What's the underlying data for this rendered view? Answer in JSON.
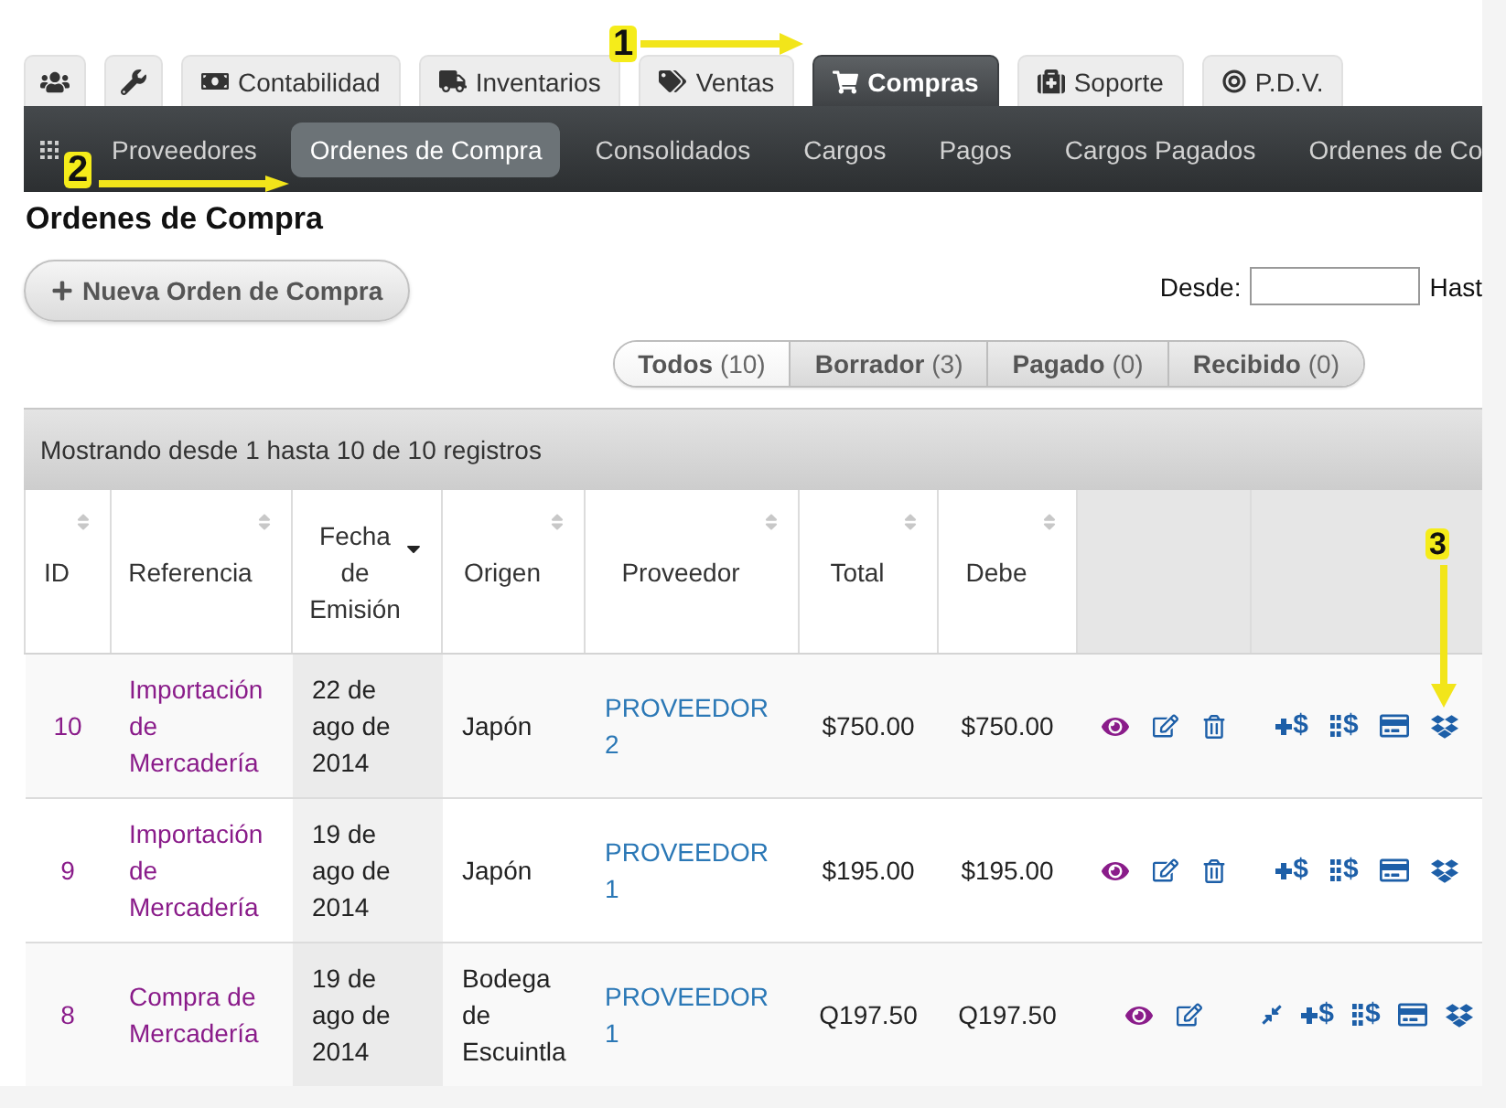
{
  "top_tabs": [
    {
      "selected": false
    },
    {
      "selected": false
    },
    {
      "label": "Contabilidad",
      "selected": false
    },
    {
      "label": "Inventarios",
      "selected": false
    },
    {
      "label": "Ventas",
      "selected": false
    },
    {
      "label": "Compras",
      "selected": true
    },
    {
      "label": "Soporte",
      "selected": false
    },
    {
      "label": "P.D.V.",
      "selected": false
    }
  ],
  "sub_nav": {
    "items": [
      {
        "label": "Proveedores",
        "selected": false
      },
      {
        "label": "Ordenes de Compra",
        "selected": true
      },
      {
        "label": "Consolidados",
        "selected": false
      },
      {
        "label": "Cargos",
        "selected": false
      },
      {
        "label": "Pagos",
        "selected": false
      },
      {
        "label": "Cargos Pagados",
        "selected": false
      },
      {
        "label": "Ordenes de Co",
        "selected": false
      }
    ]
  },
  "page_title": "Ordenes de Compra",
  "new_order_button": {
    "label": "Nueva Orden de Compra"
  },
  "date_filter": {
    "from_label": "Desde:",
    "to_label": "Hast"
  },
  "status_filters": [
    {
      "label": "Todos",
      "count": "(10)",
      "selected": true
    },
    {
      "label": "Borrador",
      "count": "(3)",
      "selected": false
    },
    {
      "label": "Pagado",
      "count": "(0)",
      "selected": false
    },
    {
      "label": "Recibido",
      "count": "(0)",
      "selected": false
    }
  ],
  "records_info": "Mostrando desde 1 hasta 10 de 10 registros",
  "table": {
    "columns": [
      {
        "kind": "data",
        "label": "ID",
        "sorted": false
      },
      {
        "kind": "data",
        "label": "Referencia",
        "sorted": false
      },
      {
        "kind": "data",
        "label": "Fecha de Emisión",
        "sorted": true
      },
      {
        "kind": "data",
        "label": "Origen",
        "sorted": false
      },
      {
        "kind": "data",
        "label": "Proveedor",
        "sorted": false
      },
      {
        "kind": "data",
        "label": "Total",
        "sorted": false
      },
      {
        "kind": "data",
        "label": "Debe",
        "sorted": false
      },
      {
        "kind": "actions"
      },
      {
        "kind": "actions"
      }
    ],
    "rows": [
      {
        "id": "10",
        "reference": "Importación de Mercadería",
        "date": "22 de ago de 2014",
        "origin": "Japón",
        "supplier": "PROVEEDOR 2",
        "total": "$750.00",
        "due": "$750.00",
        "record_actions": [
          {
            "kind": "view"
          },
          {
            "kind": "edit"
          },
          {
            "kind": "delete"
          }
        ],
        "payment_actions": [
          {
            "kind": "add-payment",
            "label": "$"
          },
          {
            "kind": "payments",
            "label": "$"
          },
          {
            "kind": "card"
          },
          {
            "kind": "box"
          }
        ]
      },
      {
        "id": "9",
        "reference": "Importación de Mercadería",
        "date": "19 de ago de 2014",
        "origin": "Japón",
        "supplier": "PROVEEDOR 1",
        "total": "$195.00",
        "due": "$195.00",
        "record_actions": [
          {
            "kind": "view"
          },
          {
            "kind": "edit"
          },
          {
            "kind": "delete"
          }
        ],
        "payment_actions": [
          {
            "kind": "add-payment",
            "label": "$"
          },
          {
            "kind": "payments",
            "label": "$"
          },
          {
            "kind": "card"
          },
          {
            "kind": "box"
          }
        ]
      },
      {
        "id": "8",
        "reference": "Compra de Mercadería",
        "date": "19 de ago de 2014",
        "origin": "Bodega de Escuintla",
        "supplier": "PROVEEDOR 1",
        "total": "Q197.50",
        "due": "Q197.50",
        "record_actions": [
          {
            "kind": "view"
          },
          {
            "kind": "edit"
          }
        ],
        "payment_actions": [
          {
            "kind": "merge"
          },
          {
            "kind": "add-payment",
            "label": "$"
          },
          {
            "kind": "payments",
            "label": "$"
          },
          {
            "kind": "card"
          },
          {
            "kind": "box"
          }
        ]
      }
    ]
  },
  "annotations": [
    {
      "label": "1"
    },
    {
      "label": "2"
    },
    {
      "label": "3"
    }
  ]
}
